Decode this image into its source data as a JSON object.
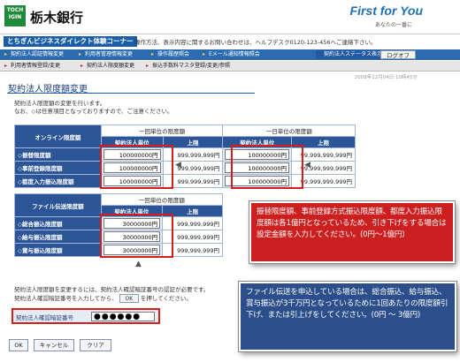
{
  "header": {
    "logo_text": "TOCHIGIN",
    "bank_name": "栃木銀行",
    "tagline": "First for You",
    "tagline_sub": "あなたの一番に"
  },
  "titlebar": {
    "service_name": "とちぎんビジネスダイレクト体験コーナー",
    "contact_text": "操作方法、表示内容に関するお問い合わせは、ヘルプデスク0120-123-456へご連絡下さい。"
  },
  "nav1": {
    "tabs": [
      "契約法人認証情報変更",
      "利用者管理情報変更",
      "操作履歴照会",
      "Eメール通知情報照会"
    ],
    "status": "契約法人ステータス表示",
    "logout": "ログオフ"
  },
  "nav2": {
    "tabs": [
      "利用者情報登録/変更",
      "契約法人限度額変更",
      "振込手数料マスタ登録/変更/参照"
    ],
    "timestamp": "2008年12月04日 10時45分"
  },
  "page": {
    "title": "契約法人限度額変更",
    "intro1": "契約法人限度額の変更を行います。",
    "intro2": "なお、◇は任意項目となっておりますので、ご注意ください。"
  },
  "online_table": {
    "section_label": "オンライン限度額",
    "once_header": "一回単位の限度額",
    "day_header": "一日単位の限度額",
    "contract_col": "契約法人単位",
    "max_col": "上限",
    "rows": [
      {
        "label": "◇振替限度額",
        "once_value": "100000000円",
        "once_max": "999,999,999円",
        "day_value": "100000000円",
        "day_max": "99,999,999,999円"
      },
      {
        "label": "◇事前登録限度額",
        "once_value": "100000000円",
        "once_max": "999,999,999円",
        "day_value": "100000000円",
        "day_max": "99,999,999,999円"
      },
      {
        "label": "◇都度入力振込限度額",
        "once_value": "100000000円",
        "once_max": "999,999,999円",
        "day_value": "100000000円",
        "day_max": "99,999,999,999円"
      }
    ]
  },
  "file_table": {
    "section_label": "ファイル伝送限度額",
    "once_header": "一回単位の限度額",
    "contract_col": "契約法人単位",
    "max_col": "上限",
    "rows": [
      {
        "label": "◇総合振込限度額",
        "value": "30000000円",
        "max": "999,999,999円"
      },
      {
        "label": "◇給与振込限度額",
        "value": "30000000円",
        "max": "999,999,999円"
      },
      {
        "label": "◇賞与振込限度額",
        "value": "30000000円",
        "max": "999,999,999円"
      }
    ]
  },
  "auth": {
    "line1": "契約法人限度額を変更するには、契約法人確認暗証番号の認証が必要です。",
    "line2_a": "契約法人確認暗証番号を入力してから、",
    "inline_ok": "OK",
    "line2_b": "を押してください。",
    "field_label": "契約法人確認暗証番号",
    "field_value": "●●●●●●"
  },
  "buttons": {
    "ok": "OK",
    "cancel": "キャンセル",
    "clear": "クリア"
  },
  "callouts": {
    "online": "振替限度額、事前登録方式振込限度額、都度入力振込限度額は各1億円となっているため、引き下げをする場合は設定金額を入力してください。(0円〜1億円)",
    "file": "ファイル伝送を申込している場合は、総合振込、給与振込、賞与振込が3千万円となっているために1回あたりの限度額引下げ、または引上げをしてください。(0円 〜 3億円)"
  },
  "colors": {
    "brand_green": "#1e8a3a",
    "nav_blue": "#2b6cb0",
    "table_header": "#2b5597",
    "highlight_red": "#d41d1d",
    "callout_red": "#cc1f1f",
    "callout_blue": "#2c4f8c"
  }
}
